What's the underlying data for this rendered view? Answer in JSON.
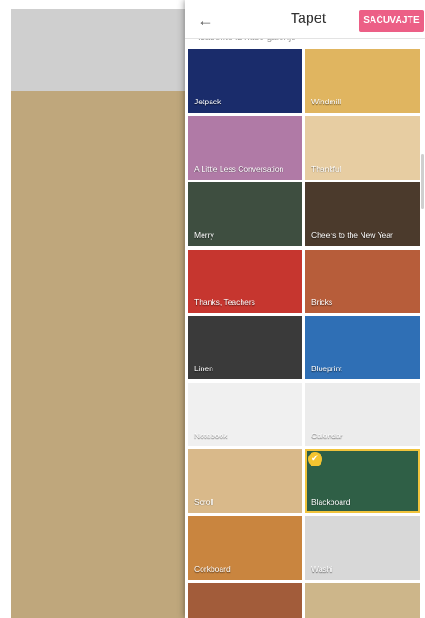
{
  "header": {
    "title": "Tapet",
    "save_label": "SAČUVAJTE",
    "back_icon": "arrow-left-icon"
  },
  "subtitle": "Izaberite iz naše galerije",
  "tiles": [
    {
      "name": "Jetpack",
      "bg": "#1a2c6b"
    },
    {
      "name": "Windmill",
      "bg": "#e0b560"
    },
    {
      "name": "A Little Less Conversation",
      "bg": "#b07aa6"
    },
    {
      "name": "Thankful",
      "bg": "#e7cda2"
    },
    {
      "name": "Merry",
      "bg": "#3e4e40"
    },
    {
      "name": "Cheers to the New Year",
      "bg": "#4b3a2c"
    },
    {
      "name": "Thanks, Teachers",
      "bg": "#c6362f"
    },
    {
      "name": "Bricks",
      "bg": "#b75d3a"
    },
    {
      "name": "Linen",
      "bg": "#3a3a3a"
    },
    {
      "name": "Blueprint",
      "bg": "#2f6fb5"
    },
    {
      "name": "Notebook",
      "bg": "#f0f0f0"
    },
    {
      "name": "Calendar",
      "bg": "#ececec"
    },
    {
      "name": "Scroll",
      "bg": "#d9b98a"
    },
    {
      "name": "Blackboard",
      "bg": "#2f5f46",
      "selected": true
    },
    {
      "name": "Corkboard",
      "bg": "#c9853f"
    },
    {
      "name": "Washi",
      "bg": "#d8d8d8"
    },
    {
      "name": "",
      "bg": "#a25c3a"
    },
    {
      "name": "",
      "bg": "#cdb68a"
    }
  ]
}
